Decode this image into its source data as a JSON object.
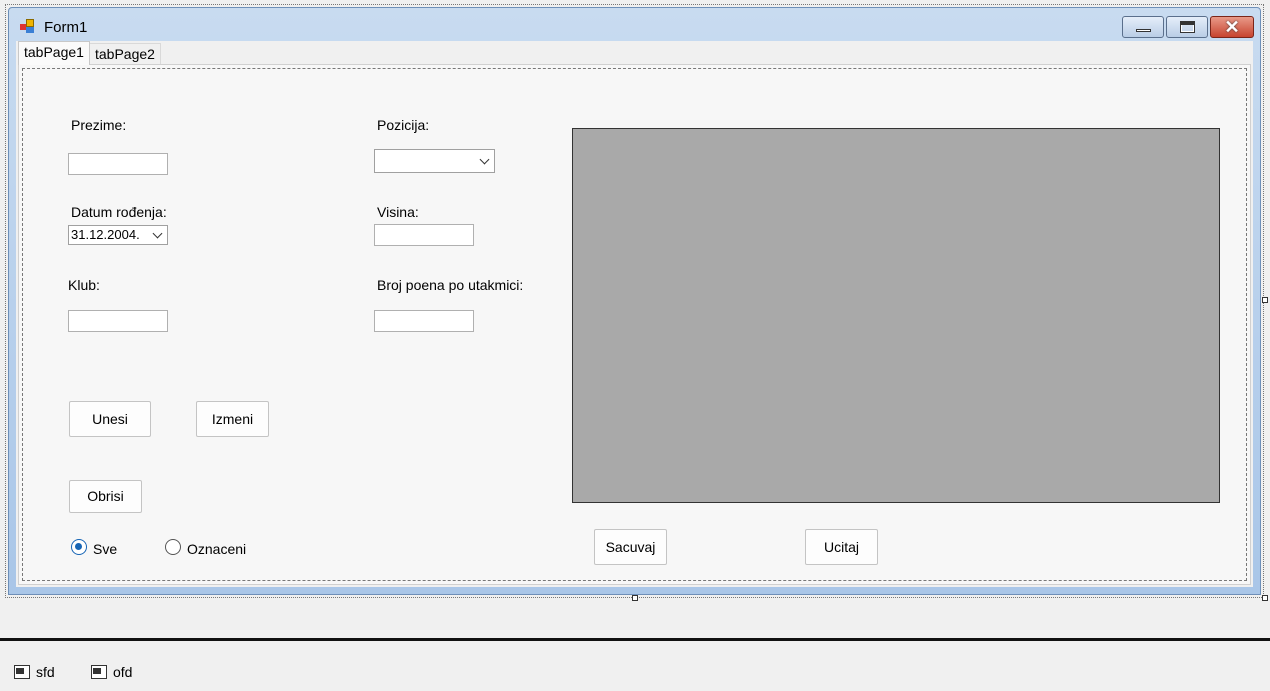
{
  "window": {
    "title": "Form1"
  },
  "tabs": [
    {
      "label": "tabPage1",
      "active": true
    },
    {
      "label": "tabPage2",
      "active": false
    }
  ],
  "form": {
    "prezime": {
      "label": "Prezime:",
      "value": ""
    },
    "datum": {
      "label": "Datum rođenja:",
      "value": "31.12.2004."
    },
    "klub": {
      "label": "Klub:",
      "value": ""
    },
    "pozicija": {
      "label": "Pozicija:",
      "value": ""
    },
    "visina": {
      "label": "Visina:",
      "value": ""
    },
    "poeni": {
      "label": "Broj poena po utakmici:",
      "value": ""
    }
  },
  "buttons": {
    "unesi": "Unesi",
    "izmeni": "Izmeni",
    "obrisi": "Obrisi",
    "sacuvaj": "Sacuvaj",
    "ucitaj": "Ucitaj"
  },
  "radios": {
    "sve": {
      "label": "Sve",
      "checked": true
    },
    "oznaceni": {
      "label": "Oznaceni",
      "checked": false
    }
  },
  "component_tray": {
    "items": [
      {
        "label": "sfd",
        "icon": "save-file-dialog-icon"
      },
      {
        "label": "ofd",
        "icon": "open-file-dialog-icon"
      }
    ]
  },
  "colors": {
    "titlebar_gradient_top": "#c8dbf0",
    "picture_fill": "#a9a9a9",
    "radio_accent": "#1765b5",
    "close_button": "#c7442f"
  }
}
